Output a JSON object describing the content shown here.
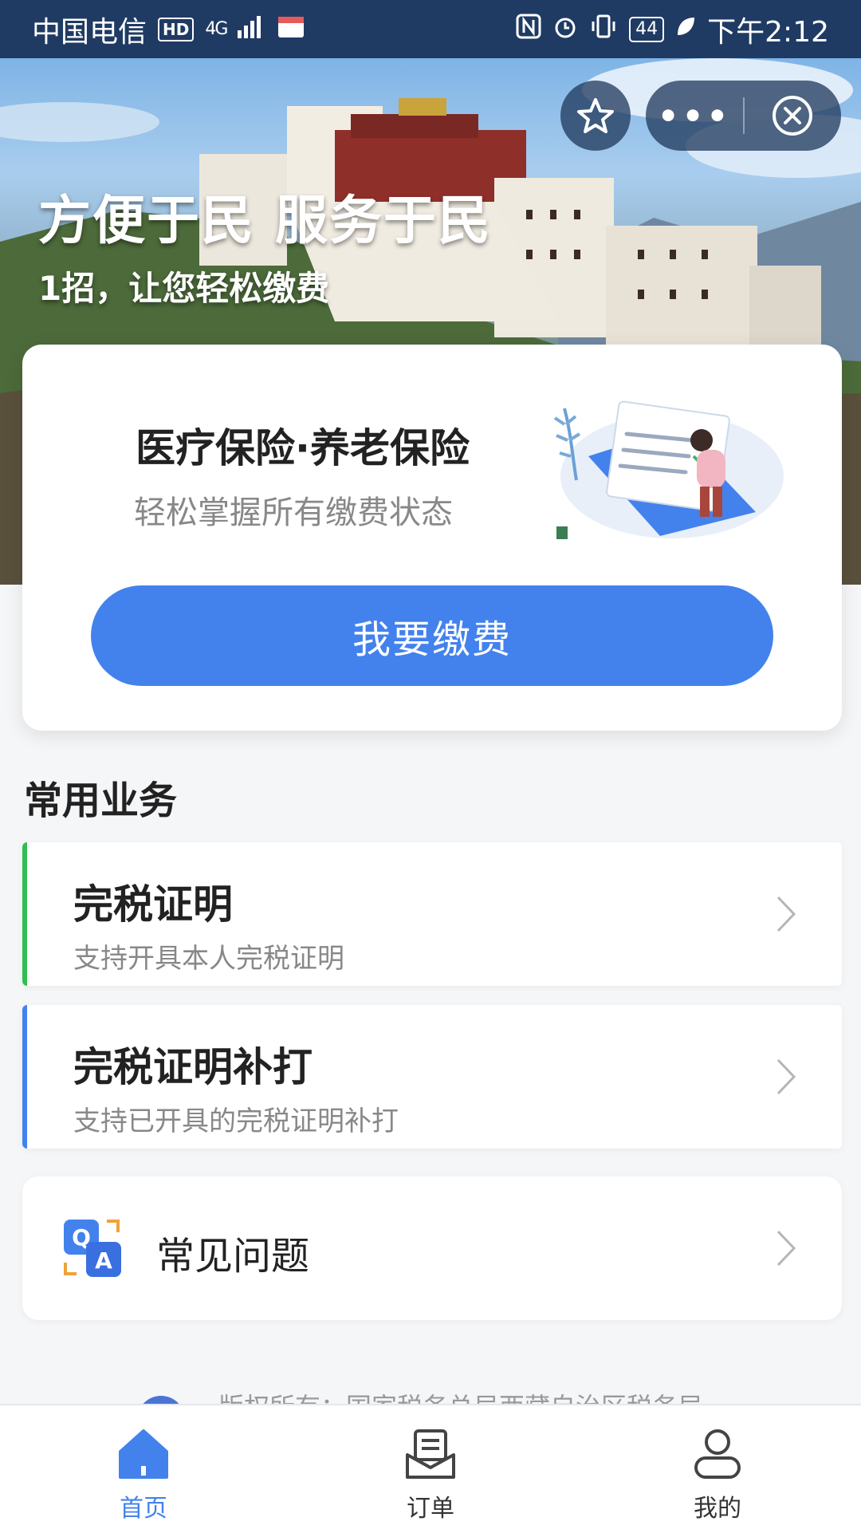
{
  "status_bar": {
    "carrier": "中国电信",
    "hd": "HD",
    "network": "4G",
    "battery": "44",
    "time": "下午2:12"
  },
  "banner": {
    "title": "方便于民 服务于民",
    "subtitle": "1招，让您轻松缴费"
  },
  "mini_program_controls": {
    "favorite_icon": "star-icon",
    "more_icon": "more-dots-icon",
    "more_label": "•••",
    "close_icon": "close-circle-icon"
  },
  "pay_card": {
    "title": "医疗保险·养老保险",
    "subtitle": "轻松掌握所有缴费状态",
    "button_label": "我要缴费"
  },
  "common_services": {
    "section_title": "常用业务",
    "items": [
      {
        "title": "完税证明",
        "desc": "支持开具本人完税证明",
        "accent": "#2fbf4f"
      },
      {
        "title": "完税证明补打",
        "desc": "支持已开具的完税证明补打",
        "accent": "#4382ed"
      }
    ]
  },
  "faq": {
    "label": "常见问题",
    "icon": "qa-icon"
  },
  "footer": {
    "copyright": "版权所有：国家税务总局西藏自治区税务局"
  },
  "tabbar": {
    "items": [
      {
        "label": "首页",
        "icon": "home-icon",
        "active": true
      },
      {
        "label": "订单",
        "icon": "order-icon",
        "active": false
      },
      {
        "label": "我的",
        "icon": "profile-icon",
        "active": false
      }
    ]
  },
  "colors": {
    "primary": "#4382ed",
    "status_bar": "#1f3b63",
    "green_accent": "#2fbf4f"
  }
}
